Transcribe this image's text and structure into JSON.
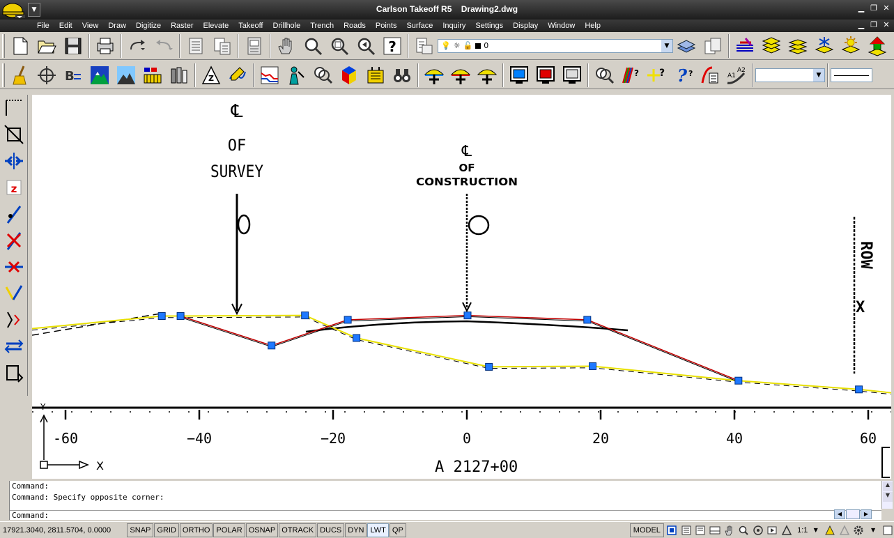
{
  "window": {
    "title": "Carlson Takeoff R5",
    "document": "Drawing2.dwg"
  },
  "menu": [
    "File",
    "Edit",
    "View",
    "Draw",
    "Digitize",
    "Raster",
    "Elevate",
    "Takeoff",
    "Drillhole",
    "Trench",
    "Roads",
    "Points",
    "Surface",
    "Inquiry",
    "Settings",
    "Display",
    "Window",
    "Help"
  ],
  "layer_combo": {
    "value": "0"
  },
  "drawing": {
    "labels": {
      "cl_survey_symbol": "℄",
      "cl_survey_of": "OF",
      "cl_survey_word": "SURVEY",
      "cl_constr_symbol": "℄",
      "cl_constr_of": "OF",
      "cl_constr_word": "CONSTRUCTION",
      "row_vertical": "ROW",
      "row_x": "X",
      "station": "A  2127+00",
      "ucs_x": "X",
      "ucs_y": "Y"
    },
    "axis_ticks": [
      {
        "value": -60,
        "label": "-60"
      },
      {
        "value": -40,
        "label": "−40"
      },
      {
        "value": -20,
        "label": "−20"
      },
      {
        "value": 0,
        "label": "0"
      },
      {
        "value": 20,
        "label": "20"
      },
      {
        "value": 40,
        "label": "40"
      },
      {
        "value": 60,
        "label": "60"
      }
    ],
    "yellow_polyline": [
      [
        -65,
        12.5
      ],
      [
        -45.6,
        14.5
      ],
      [
        -42.8,
        14.5
      ],
      [
        -24.2,
        14.6
      ],
      [
        -16.5,
        11.0
      ],
      [
        3.3,
        6.4
      ],
      [
        18.8,
        6.5
      ],
      [
        40.6,
        4.2
      ],
      [
        58.6,
        2.8
      ],
      [
        64,
        2.2
      ]
    ],
    "red_polyline": [
      [
        -42.8,
        14.5
      ],
      [
        -29.2,
        9.8
      ],
      [
        -17.8,
        13.9
      ],
      [
        0.1,
        14.6
      ],
      [
        18.0,
        13.9
      ],
      [
        40.6,
        4.2
      ]
    ],
    "vertices": [
      [
        -45.6,
        14.5
      ],
      [
        -42.8,
        14.5
      ],
      [
        -29.2,
        9.8
      ],
      [
        -24.2,
        14.6
      ],
      [
        -17.8,
        13.9
      ],
      [
        -16.5,
        11.0
      ],
      [
        0.1,
        14.6
      ],
      [
        18.0,
        13.9
      ],
      [
        3.3,
        6.4
      ],
      [
        18.8,
        6.5
      ],
      [
        40.6,
        4.2
      ],
      [
        58.6,
        2.8
      ]
    ]
  },
  "command": {
    "history": [
      "Command:",
      "Command: Specify opposite corner:"
    ],
    "prompt": "Command:"
  },
  "status": {
    "coords": "17921.3040, 2811.5704, 0.0000",
    "toggles": [
      {
        "label": "SNAP",
        "on": false
      },
      {
        "label": "GRID",
        "on": false
      },
      {
        "label": "ORTHO",
        "on": false
      },
      {
        "label": "POLAR",
        "on": false
      },
      {
        "label": "OSNAP",
        "on": false
      },
      {
        "label": "OTRACK",
        "on": false
      },
      {
        "label": "DUCS",
        "on": false
      },
      {
        "label": "DYN",
        "on": false
      },
      {
        "label": "LWT",
        "on": true
      },
      {
        "label": "QP",
        "on": false
      }
    ],
    "model": "MODEL",
    "scale": "1:1"
  }
}
